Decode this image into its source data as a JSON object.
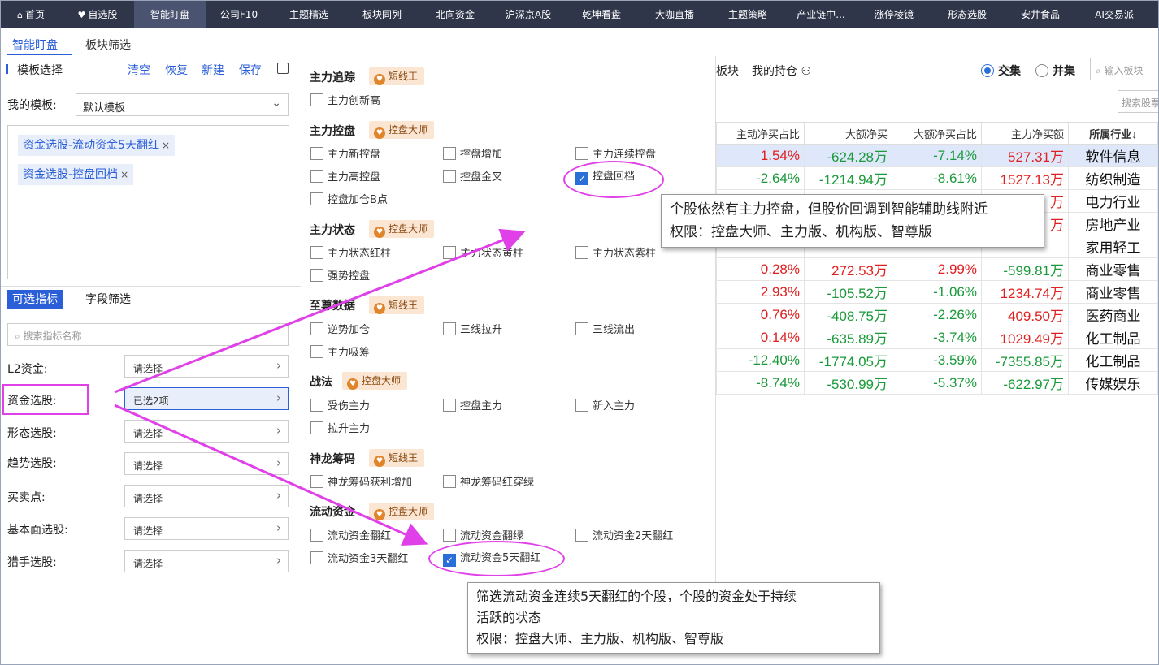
{
  "topnav": [
    {
      "label": "首页",
      "icon": "home-icon",
      "glyph": "⌂"
    },
    {
      "label": "自选股",
      "icon": "heart-icon",
      "glyph": "♥"
    },
    {
      "label": "智能盯盘",
      "active": true
    },
    {
      "label": "公司F10"
    },
    {
      "label": "主题精选"
    },
    {
      "label": "板块同列"
    },
    {
      "label": "北向资金"
    },
    {
      "label": "沪深京A股"
    },
    {
      "label": "乾坤看盘"
    },
    {
      "label": "大咖直播"
    },
    {
      "label": "主题策略"
    },
    {
      "label": "产业链中..."
    },
    {
      "label": "涨停棱镜"
    },
    {
      "label": "形态选股"
    },
    {
      "label": "安井食品"
    },
    {
      "label": "AI交易派"
    }
  ],
  "subtabs": {
    "smart": "智能盯盘",
    "sector": "板块筛选"
  },
  "left": {
    "template_select_title": "模板选择",
    "actions": {
      "clear": "清空",
      "restore": "恢复",
      "new": "新建",
      "save": "保存"
    },
    "my_template_label": "我的模板:",
    "my_template_value": "默认模板",
    "tags": [
      "资金选股-流动资金5天翻红",
      "资金选股-控盘回档"
    ],
    "tag_close": "×",
    "tabs": {
      "optional": "可选指标",
      "field": "字段筛选"
    },
    "search_placeholder": "搜索指标名称",
    "filters": [
      {
        "label": "L2资金:",
        "value": "请选择"
      },
      {
        "label": "资金选股:",
        "value": "已选2项",
        "selected": true
      },
      {
        "label": "形态选股:",
        "value": "请选择"
      },
      {
        "label": "趋势选股:",
        "value": "请选择"
      },
      {
        "label": "买卖点:",
        "value": "请选择"
      },
      {
        "label": "基本面选股:",
        "value": "请选择"
      },
      {
        "label": "猎手选股:",
        "value": "请选择"
      }
    ]
  },
  "dropdown": {
    "categories": [
      {
        "title": "主力追踪",
        "badge": "短线王"
      },
      {
        "title": "主力控盘",
        "badge": "控盘大师"
      },
      {
        "title": "主力状态",
        "badge": "控盘大师"
      },
      {
        "title": "至尊数据",
        "badge": "短线王"
      },
      {
        "title": "战法",
        "badge": "控盘大师"
      },
      {
        "title": "神龙筹码",
        "badge": "短线王"
      },
      {
        "title": "流动资金",
        "badge": "控盘大师"
      }
    ],
    "items": [
      {
        "label": "主力创新高"
      },
      {
        "label": "主力新控盘"
      },
      {
        "label": "控盘增加"
      },
      {
        "label": "主力连续控盘"
      },
      {
        "label": "主力高控盘"
      },
      {
        "label": "控盘金叉"
      },
      {
        "label": "控盘回档",
        "checked": true
      },
      {
        "label": "控盘加仓B点"
      },
      {
        "label": "主力状态红柱"
      },
      {
        "label": "主力状态黄柱"
      },
      {
        "label": "主力状态紫柱"
      },
      {
        "label": "强势控盘"
      },
      {
        "label": "逆势加仓"
      },
      {
        "label": "三线拉升"
      },
      {
        "label": "三线流出"
      },
      {
        "label": "主力吸筹"
      },
      {
        "label": "受伤主力"
      },
      {
        "label": "控盘主力"
      },
      {
        "label": "新入主力"
      },
      {
        "label": "拉升主力"
      },
      {
        "label": "神龙筹码获利增加"
      },
      {
        "label": "神龙筹码红穿绿"
      },
      {
        "label": "流动资金翻红"
      },
      {
        "label": "流动资金翻绿"
      },
      {
        "label": "流动资金2天翻红"
      },
      {
        "label": "流动资金3天翻红"
      },
      {
        "label": "流动资金5天翻红",
        "checked": true
      }
    ],
    "check_mark": "✓"
  },
  "right": {
    "tabs": {
      "sector": "板块",
      "holdings": "我的持仓"
    },
    "radios": {
      "intersect": "交集",
      "union": "并集"
    },
    "search_placeholder": "输入板块",
    "search2_placeholder": "搜索股票",
    "columns": [
      "主动净买占比",
      "大额净买",
      "大额净买占比",
      "主力净买额",
      "所属行业↓"
    ],
    "rows": [
      [
        "1.54%",
        "-624.28万",
        "-7.14%",
        "527.31万",
        "软件信息"
      ],
      [
        "-2.64%",
        "-1214.94万",
        "-8.61%",
        "1527.13万",
        "纺织制造"
      ],
      [
        "",
        "",
        "",
        "万",
        "电力行业"
      ],
      [
        "",
        "",
        "",
        "万",
        "房地产业"
      ],
      [
        "",
        "",
        "",
        "",
        "家用轻工"
      ],
      [
        "0.28%",
        "272.53万",
        "2.99%",
        "-599.81万",
        "商业零售"
      ],
      [
        "2.93%",
        "-105.52万",
        "-1.06%",
        "1234.74万",
        "商业零售"
      ],
      [
        "0.76%",
        "-408.75万",
        "-2.26%",
        "409.50万",
        "医药商业"
      ],
      [
        "0.14%",
        "-635.89万",
        "-3.74%",
        "1029.49万",
        "化工制品"
      ],
      [
        "-12.40%",
        "-1774.05万",
        "-3.59%",
        "-7355.85万",
        "化工制品"
      ],
      [
        "-8.74%",
        "-530.99万",
        "-5.37%",
        "-622.97万",
        "传媒娱乐"
      ]
    ]
  },
  "tooltips": {
    "kongpan": [
      "个股依然有主力控盘，但股价回调到智能辅助线附近",
      "权限：控盘大师、主力版、机构版、智尊版"
    ],
    "liudong": [
      "筛选流动资金连续5天翻红的个股，个股的资金处于持续",
      "活跃的状态",
      "权限：控盘大师、主力版、机构版、智尊版"
    ]
  },
  "colors": {
    "accent": "#2a5fd8",
    "nav": "#2f364a",
    "annotation": "#e040e8",
    "up": "#e02020",
    "down": "#1a9a3a"
  }
}
